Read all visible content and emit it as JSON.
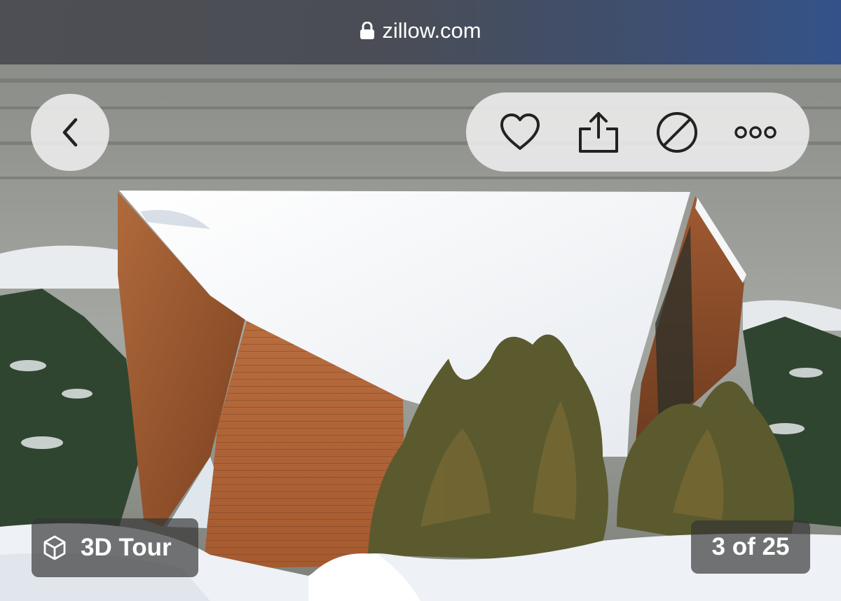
{
  "browser": {
    "url": "zillow.com",
    "lock_icon": "lock-icon"
  },
  "gallery": {
    "back_icon": "chevron-left-icon",
    "actions": [
      {
        "icon": "heart-icon",
        "action": "save"
      },
      {
        "icon": "share-icon",
        "action": "share"
      },
      {
        "icon": "hide-icon",
        "action": "hide"
      },
      {
        "icon": "more-icon",
        "action": "more"
      }
    ],
    "tour_label": "3D Tour",
    "tour_icon": "cube-icon",
    "counter": "3 of 25",
    "current_photo": 3,
    "total_photos": 25
  },
  "colors": {
    "overlay_light": "#eeeeee",
    "overlay_dark": "#343434",
    "icon": "#222222",
    "text_on_dark": "#ffffff"
  }
}
